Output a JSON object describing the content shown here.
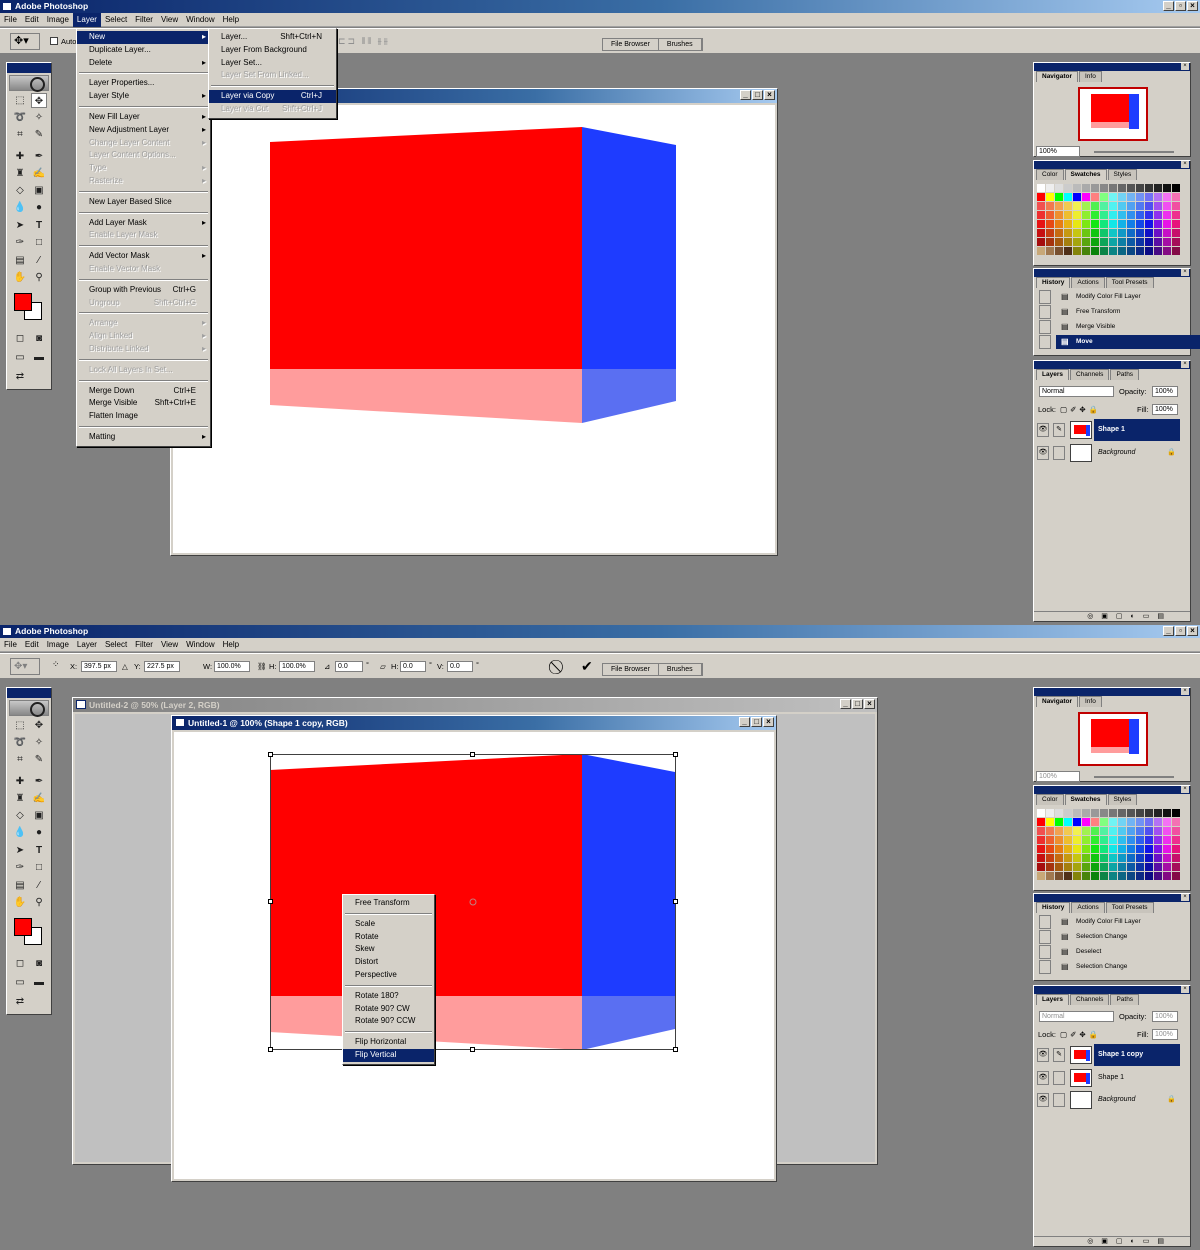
{
  "colors": {
    "red": "#ff0000",
    "blue": "#1e3cff",
    "pink": "#ff9c9c",
    "lightblue": "#5a6ff2",
    "selection": "#0a246a"
  },
  "screen1": {
    "app_title": "Adobe Photoshop",
    "menubar": [
      "File",
      "Edit",
      "Image",
      "Layer",
      "Select",
      "Filter",
      "View",
      "Window",
      "Help"
    ],
    "optbar_auto": "Auto",
    "tabs": [
      "File Browser",
      "Brushes"
    ],
    "layer_menu": [
      {
        "label": "New",
        "sub": true,
        "state": "selected"
      },
      {
        "label": "Duplicate Layer..."
      },
      {
        "label": "Delete",
        "sub": true
      },
      {
        "sep": true
      },
      {
        "label": "Layer Properties..."
      },
      {
        "label": "Layer Style",
        "sub": true
      },
      {
        "sep": true
      },
      {
        "label": "New Fill Layer",
        "sub": true
      },
      {
        "label": "New Adjustment Layer",
        "sub": true
      },
      {
        "label": "Change Layer Content",
        "sub": true,
        "state": "disabled"
      },
      {
        "label": "Layer Content Options...",
        "state": "disabled"
      },
      {
        "label": "Type",
        "sub": true,
        "state": "disabled"
      },
      {
        "label": "Rasterize",
        "sub": true,
        "state": "disabled"
      },
      {
        "sep": true
      },
      {
        "label": "New Layer Based Slice"
      },
      {
        "sep": true
      },
      {
        "label": "Add Layer Mask",
        "sub": true
      },
      {
        "label": "Enable Layer Mask",
        "state": "disabled"
      },
      {
        "sep": true
      },
      {
        "label": "Add Vector Mask",
        "sub": true
      },
      {
        "label": "Enable Vector Mask",
        "state": "disabled"
      },
      {
        "sep": true
      },
      {
        "label": "Group with Previous",
        "shortcut": "Ctrl+G"
      },
      {
        "label": "Ungroup",
        "shortcut": "Shft+Ctrl+G",
        "state": "disabled"
      },
      {
        "sep": true
      },
      {
        "label": "Arrange",
        "sub": true,
        "state": "disabled"
      },
      {
        "label": "Align Linked",
        "sub": true,
        "state": "disabled"
      },
      {
        "label": "Distribute Linked",
        "sub": true,
        "state": "disabled"
      },
      {
        "sep": true
      },
      {
        "label": "Lock All Layers In Set...",
        "state": "disabled"
      },
      {
        "sep": true
      },
      {
        "label": "Merge Down",
        "shortcut": "Ctrl+E"
      },
      {
        "label": "Merge Visible",
        "shortcut": "Shft+Ctrl+E"
      },
      {
        "label": "Flatten Image"
      },
      {
        "sep": true
      },
      {
        "label": "Matting",
        "sub": true
      }
    ],
    "new_submenu": [
      {
        "label": "Layer...",
        "shortcut": "Shft+Ctrl+N"
      },
      {
        "label": "Layer From Background"
      },
      {
        "label": "Layer Set..."
      },
      {
        "label": "Layer Set From Linked...",
        "state": "disabled"
      },
      {
        "sep": true
      },
      {
        "label": "Layer via Copy",
        "shortcut": "Ctrl+J",
        "state": "selected"
      },
      {
        "label": "Layer via Cut",
        "shortcut": "Shft+Ctrl+J",
        "state": "disabled"
      }
    ],
    "navigator": {
      "tabs": [
        "Navigator",
        "Info"
      ],
      "zoom": "100%"
    },
    "swatches_tabs": [
      "Color",
      "Swatches",
      "Styles"
    ],
    "history": {
      "tabs": [
        "History",
        "Actions",
        "Tool Presets"
      ],
      "items": [
        "Modify Color Fill Layer",
        "Free Transform",
        "Merge Visible",
        "Move"
      ],
      "active": 3
    },
    "layers": {
      "tabs": [
        "Layers",
        "Channels",
        "Paths"
      ],
      "blend": "Normal",
      "opacity_label": "Opacity:",
      "opacity": "100%",
      "lock_label": "Lock:",
      "fill_label": "Fill:",
      "fill": "100%",
      "rows": [
        "Shape 1",
        "Background"
      ],
      "active": 0
    }
  },
  "screen2": {
    "app_title": "Adobe Photoshop",
    "menubar": [
      "File",
      "Edit",
      "Image",
      "Layer",
      "Select",
      "Filter",
      "View",
      "Window",
      "Help"
    ],
    "opt": {
      "x_label": "X:",
      "x": "397.5 px",
      "y_label": "Y:",
      "y": "227.5 px",
      "w_label": "W:",
      "w": "100.0%",
      "h_label": "H:",
      "h": "100.0%",
      "angle": "0.0",
      "hs_label": "H:",
      "hs": "0.0",
      "vs_label": "V:",
      "vs": "0.0"
    },
    "tabs": [
      "File Browser",
      "Brushes"
    ],
    "back_doc_title": "Untitled-2 @ 50% (Layer 2, RGB)",
    "doc_title": "Untitled-1 @ 100% (Shape 1 copy, RGB)",
    "context_menu": [
      {
        "label": "Free Transform"
      },
      {
        "sep": true
      },
      {
        "label": "Scale"
      },
      {
        "label": "Rotate"
      },
      {
        "label": "Skew"
      },
      {
        "label": "Distort"
      },
      {
        "label": "Perspective"
      },
      {
        "sep": true
      },
      {
        "label": "Rotate 180?"
      },
      {
        "label": "Rotate 90? CW"
      },
      {
        "label": "Rotate 90? CCW"
      },
      {
        "sep": true
      },
      {
        "label": "Flip Horizontal"
      },
      {
        "label": "Flip Vertical",
        "state": "selected"
      }
    ],
    "navigator": {
      "tabs": [
        "Navigator",
        "Info"
      ],
      "zoom": "100%"
    },
    "swatches_tabs": [
      "Color",
      "Swatches",
      "Styles"
    ],
    "history": {
      "tabs": [
        "History",
        "Actions",
        "Tool Presets"
      ],
      "items": [
        "Modify Color Fill Layer",
        "Selection Change",
        "Deselect",
        "Selection Change"
      ],
      "active": -1
    },
    "layers": {
      "tabs": [
        "Layers",
        "Channels",
        "Paths"
      ],
      "blend": "Normal",
      "opacity_label": "Opacity:",
      "opacity": "100%",
      "lock_label": "Lock:",
      "fill_label": "Fill:",
      "fill": "100%",
      "rows": [
        "Shape 1 copy",
        "Shape 1",
        "Background"
      ],
      "active": 0
    }
  }
}
